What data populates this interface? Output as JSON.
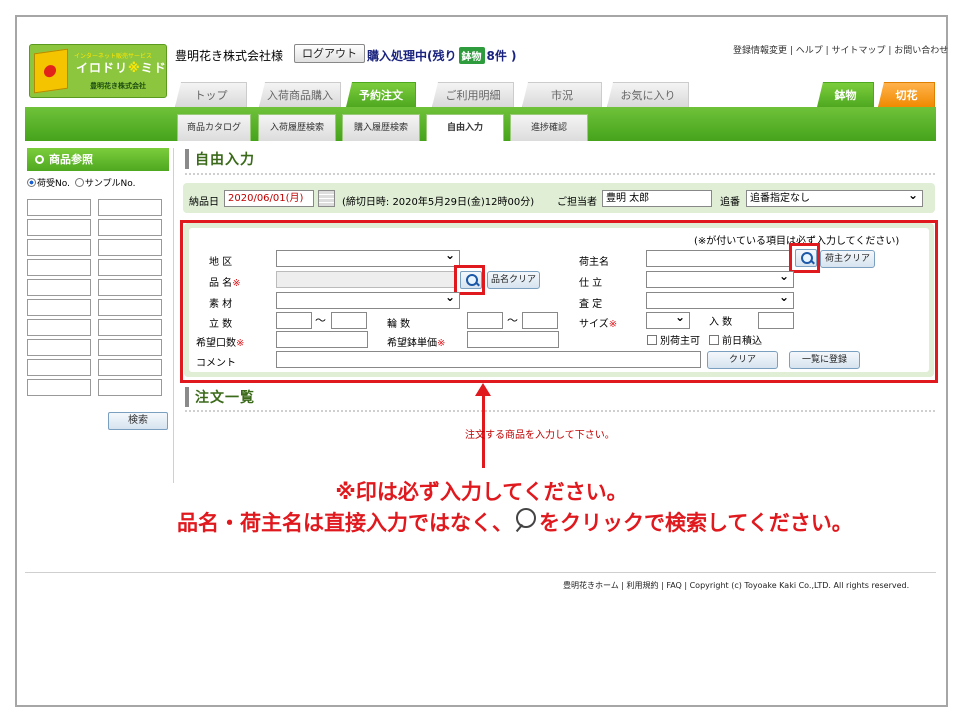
{
  "header": {
    "logo_small": "インターネット販売サービス",
    "logo_name_a": "イロドリ",
    "logo_sep": "※",
    "logo_name_b": "ミドリ",
    "logo_company": "豊明花き株式会社",
    "company": "豊明花き株式会社様",
    "logout": "ログアウト",
    "status_prefix": "購入処理中(残り",
    "status_badge": "鉢物",
    "status_count": "8件 )",
    "top_links": "登録情報変更 | ヘルプ | サイトマップ | お問い合わせ"
  },
  "main_tabs": [
    {
      "label": "トップ"
    },
    {
      "label": "入荷商品購入"
    },
    {
      "label": "予約注文"
    },
    {
      "label": "ご利用明細"
    },
    {
      "label": "市況"
    },
    {
      "label": "お気に入り"
    }
  ],
  "category_tabs": [
    {
      "label": "鉢物"
    },
    {
      "label": "切花"
    }
  ],
  "sub_tabs": [
    {
      "label": "商品カタログ"
    },
    {
      "label": "入荷履歴検索"
    },
    {
      "label": "購入履歴検索"
    },
    {
      "label": "自由入力"
    },
    {
      "label": "進捗確認"
    }
  ],
  "sidebar": {
    "title": "商品参照",
    "radio1": "荷受No.",
    "radio2": "サンプルNo.",
    "search": "検索"
  },
  "main": {
    "title": "自由入力",
    "delivery_label": "納品日",
    "delivery_value": "2020/06/01(月)",
    "deadline": "(締切日時: 2020年5月29日(金)12時00分)",
    "staff_label": "ご担当者",
    "staff_value": "豊明 太郎",
    "seq_label": "追番",
    "seq_value": "追番指定なし",
    "required_note": "(※が付いている項目は必ず入力してください)",
    "order_list_title": "注文一覧"
  },
  "form": {
    "area_label": "地 区",
    "item_label": "品 名",
    "item_clear": "品名クリア",
    "material_label": "素 材",
    "stems_label": "立 数",
    "wheels_label": "輪 数",
    "qty_label": "希望口数",
    "price_label": "希望鉢単価",
    "comment_label": "コメント",
    "owner_label": "荷主名",
    "owner_clear": "荷主クリア",
    "finish_label": "仕 立",
    "grade_label": "査 定",
    "size_label": "サイズ",
    "irisu_label": "入 数",
    "other_owner": "別荷主可",
    "prev_day": "前日積込",
    "clear_btn": "クリア",
    "register_btn": "一覧に登録",
    "req_mark": "※",
    "tilde": "〜"
  },
  "annotations": {
    "small": "注文する商品を入力して下さい。",
    "line1": "※印は必ず入力してください。",
    "line2a": "品名・荷主名は直接入力ではなく、",
    "line2b": "をクリックで検索してください。"
  },
  "footer": "豊明花きホーム | 利用規約 | FAQ |  Copyright (c) Toyoake Kaki Co.,LTD. All rights reserved."
}
